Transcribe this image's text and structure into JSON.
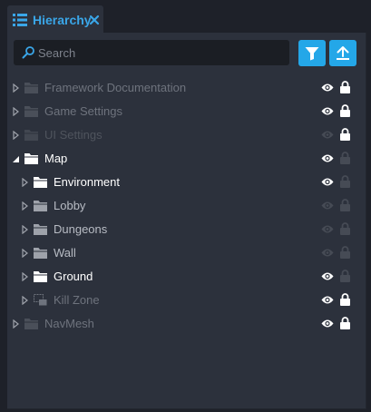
{
  "tab": {
    "title": "Hierarchy"
  },
  "search": {
    "placeholder": "Search",
    "value": ""
  },
  "tree": [
    {
      "label": "Framework Documentation"
    },
    {
      "label": "Game Settings"
    },
    {
      "label": "UI Settings"
    },
    {
      "label": "Map"
    },
    {
      "label": "Environment"
    },
    {
      "label": "Lobby"
    },
    {
      "label": "Dungeons"
    },
    {
      "label": "Wall"
    },
    {
      "label": "Ground"
    },
    {
      "label": "Kill Zone"
    },
    {
      "label": "NavMesh"
    }
  ]
}
